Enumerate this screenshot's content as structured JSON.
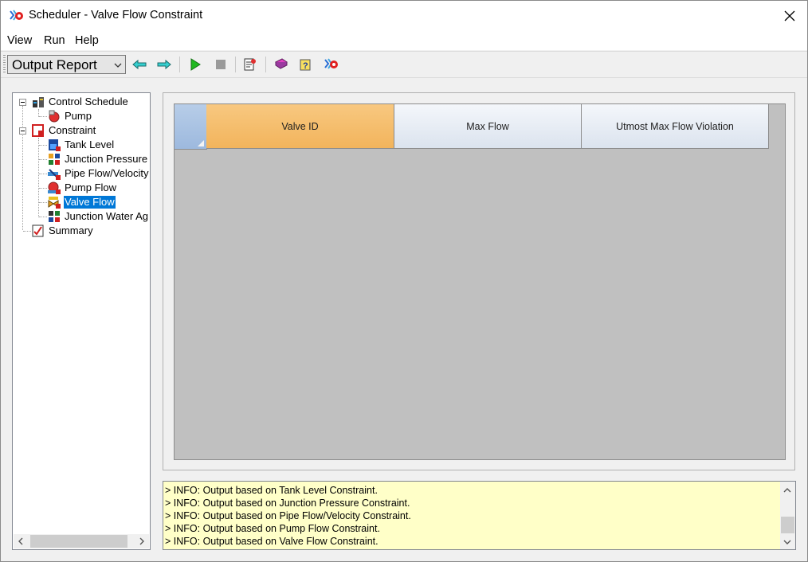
{
  "window": {
    "title": "Scheduler - Valve Flow Constraint",
    "app_icon": "scheduler-app-icon",
    "close_icon": "close-icon"
  },
  "menu": [
    "View",
    "Run",
    "Help"
  ],
  "toolbar": {
    "combo_value": "Output Report",
    "buttons": [
      "back-arrow-icon",
      "forward-arrow-icon",
      "run-play-icon",
      "stop-icon",
      "output-report-icon",
      "help-book-icon",
      "help-question-icon",
      "scheduler-icon"
    ]
  },
  "tree": {
    "items": [
      {
        "label": "Control Schedule",
        "icon": "control-schedule-icon",
        "level": 0,
        "expanded": true
      },
      {
        "label": "Pump",
        "icon": "pump-icon",
        "level": 1
      },
      {
        "label": "Constraint",
        "icon": "constraint-icon",
        "level": 0,
        "expanded": true
      },
      {
        "label": "Tank Level",
        "icon": "tank-level-icon",
        "level": 1
      },
      {
        "label": "Junction Pressure",
        "icon": "junction-pressure-icon",
        "level": 1
      },
      {
        "label": "Pipe Flow/Velocity",
        "icon": "pipe-flow-icon",
        "level": 1
      },
      {
        "label": "Pump Flow",
        "icon": "pump-flow-icon",
        "level": 1
      },
      {
        "label": "Valve Flow",
        "icon": "valve-flow-icon",
        "level": 1,
        "selected": true
      },
      {
        "label": "Junction Water Ag",
        "icon": "junction-water-age-icon",
        "level": 1
      },
      {
        "label": "Summary",
        "icon": "summary-icon",
        "level": 0
      }
    ]
  },
  "grid": {
    "columns": [
      "Valve ID",
      "Max Flow",
      "Utmost Max Flow Violation"
    ],
    "active_column": 0
  },
  "log": [
    "> INFO: Output based on Tank Level Constraint.",
    "> INFO: Output based on Junction Pressure Constraint.",
    "> INFO: Output based on Pipe Flow/Velocity Constraint.",
    "> INFO: Output based on Pump Flow Constraint.",
    "> INFO: Output based on Valve Flow Constraint."
  ]
}
